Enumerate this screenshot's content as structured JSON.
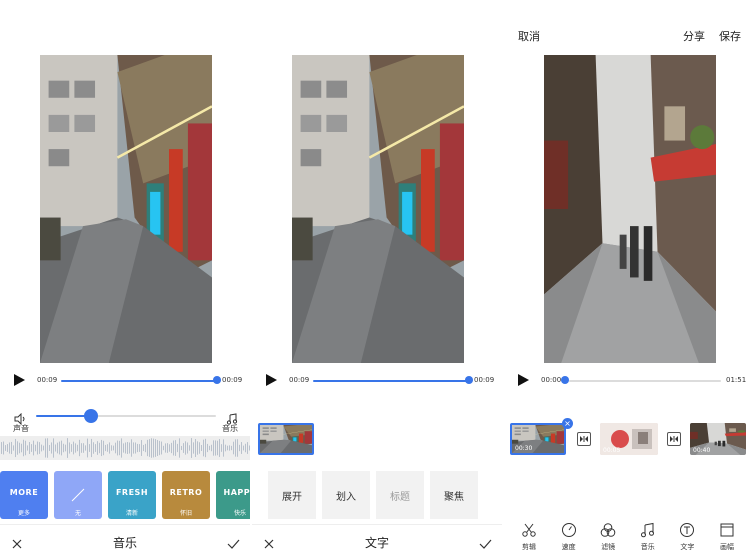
{
  "music_panel": {
    "time_current": "00:09",
    "time_total": "00:09",
    "voice_label": "声音",
    "music_label": "音乐",
    "filters": [
      {
        "name": "MORE",
        "label": "更多",
        "color": "#4f7ff0"
      },
      {
        "name": "",
        "label": "无",
        "color": "#8fa7f7"
      },
      {
        "name": "FRESH",
        "label": "清新",
        "color": "#3aa3c8"
      },
      {
        "name": "RETRO",
        "label": "怀旧",
        "color": "#b88a3d"
      },
      {
        "name": "HAPPY",
        "label": "快乐",
        "color": "#3c9a8a"
      }
    ],
    "bottom_title": "音乐"
  },
  "text_panel": {
    "time_current": "00:09",
    "time_total": "00:09",
    "styles": [
      "展开",
      "划入",
      "标题",
      "聚焦"
    ],
    "bottom_title": "文字"
  },
  "editor_panel": {
    "cancel_label": "取消",
    "share_label": "分享",
    "save_label": "保存",
    "time_current": "00:00",
    "time_total": "01:51",
    "clips": [
      {
        "duration": "00:30"
      },
      {
        "duration": "00:05"
      },
      {
        "duration": "00:40"
      }
    ],
    "tools": [
      {
        "label": "剪辑",
        "icon": "scissors-icon"
      },
      {
        "label": "速度",
        "icon": "speed-icon"
      },
      {
        "label": "滤镜",
        "icon": "filter-icon"
      },
      {
        "label": "音乐",
        "icon": "music-note-icon"
      },
      {
        "label": "文字",
        "icon": "text-icon"
      },
      {
        "label": "画幅",
        "icon": "aspect-ratio-icon"
      }
    ]
  },
  "colors": {
    "accent": "#3874e8"
  }
}
